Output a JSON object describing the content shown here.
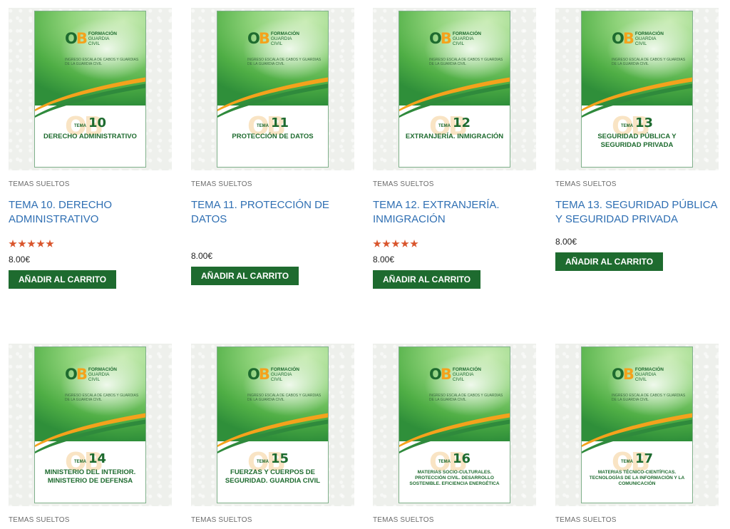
{
  "brand": {
    "mark_o": "O",
    "mark_b": "B",
    "line1": "FORMACIÓN",
    "line2": "GUARDIA",
    "line3": "CIVIL",
    "cover_subtitle": "INGRESO ESCALA DE CABOS Y GUARDIAS DE LA GUARDIA CIVIL",
    "tema_word": "TEMA"
  },
  "products": [
    {
      "category": "TEMAS SUELTOS",
      "title": "TEMA 10. DERECHO ADMINISTRATIVO",
      "cover_num": "10",
      "cover_title": "DERECHO ADMINISTRATIVO",
      "rating": 5,
      "price": "8.00€",
      "button": "AÑADIR AL CARRITO"
    },
    {
      "category": "TEMAS SUELTOS",
      "title": "TEMA 11. PROTECCIÓN DE DATOS",
      "cover_num": "11",
      "cover_title": "PROTECCIÓN DE DATOS",
      "rating": 0,
      "price": "8.00€",
      "button": "AÑADIR AL CARRITO"
    },
    {
      "category": "TEMAS SUELTOS",
      "title": "TEMA 12. EXTRANJERÍA. INMIGRACIÓN",
      "cover_num": "12",
      "cover_title": "EXTRANJERÍA. INMIGRACIÓN",
      "rating": 5,
      "price": "8.00€",
      "button": "AÑADIR AL CARRITO"
    },
    {
      "category": "TEMAS SUELTOS",
      "title": "TEMA 13. SEGURIDAD PÚBLICA Y SEGURIDAD PRIVADA",
      "cover_num": "13",
      "cover_title": "SEGURIDAD PÚBLICA Y SEGURIDAD PRIVADA",
      "rating": 0,
      "price": "8.00€",
      "button": "AÑADIR AL CARRITO"
    },
    {
      "category": "TEMAS SUELTOS",
      "cover_num": "14",
      "cover_title": "MINISTERIO DEL INTERIOR. MINISTERIO DE DEFENSA"
    },
    {
      "category": "TEMAS SUELTOS",
      "cover_num": "15",
      "cover_title": "FUERZAS Y CUERPOS DE SEGURIDAD. GUARDIA CIVIL"
    },
    {
      "category": "TEMAS SUELTOS",
      "cover_num": "16",
      "cover_title": "MATERIAS SOCIO-CULTURALES. PROTECCIÓN CIVIL. DESARROLLO SOSTENIBLE. EFICIENCIA ENERGÉTICA"
    },
    {
      "category": "TEMAS SUELTOS",
      "cover_num": "17",
      "cover_title": "MATERIAS TÉCNICO-CIENTÍFICAS. TECNOLOGÍAS DE LA INFORMACIÓN Y LA COMUNICACIÓN"
    }
  ],
  "colors": {
    "button_bg": "#1e6b2f",
    "title_link": "#2f6fb3",
    "star": "#d9542b",
    "accent_orange": "#f4a21c"
  }
}
